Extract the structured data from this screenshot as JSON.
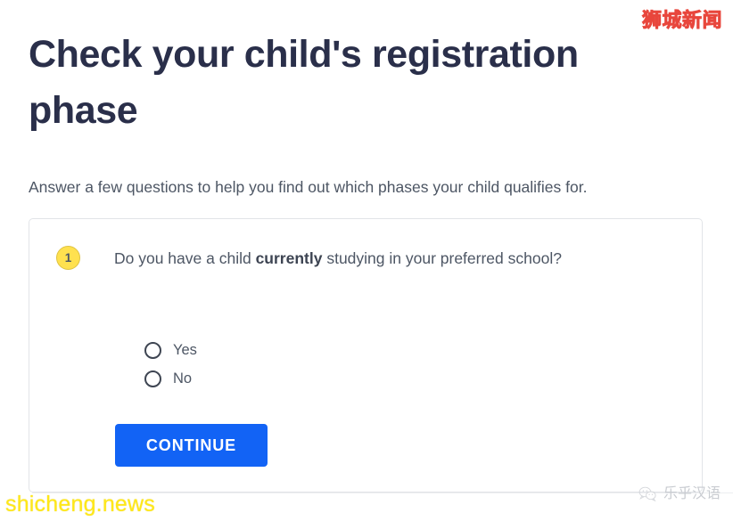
{
  "heading": "Check your child's registration phase",
  "subtitle": "Answer a few questions to help you find out which phases your child qualifies for.",
  "question_card": {
    "step_number": "1",
    "question_prefix": "Do you have a child ",
    "question_emphasis": "currently",
    "question_suffix": " studying in your preferred school?",
    "options": [
      {
        "label": "Yes",
        "selected": false
      },
      {
        "label": "No",
        "selected": false
      }
    ],
    "continue_label": "CONTINUE"
  },
  "watermarks": {
    "top_right": "狮城新闻",
    "bottom_left": "shicheng.news",
    "bottom_right": "乐乎汉语"
  },
  "colors": {
    "heading": "#2a2f4a",
    "body_text": "#4d5664",
    "badge_yellow": "#ffe14f",
    "button_blue": "#1263f5",
    "card_border": "#e2e4e8",
    "watermark_yellow": "#ffe400",
    "watermark_gray": "#c9ccd1"
  }
}
